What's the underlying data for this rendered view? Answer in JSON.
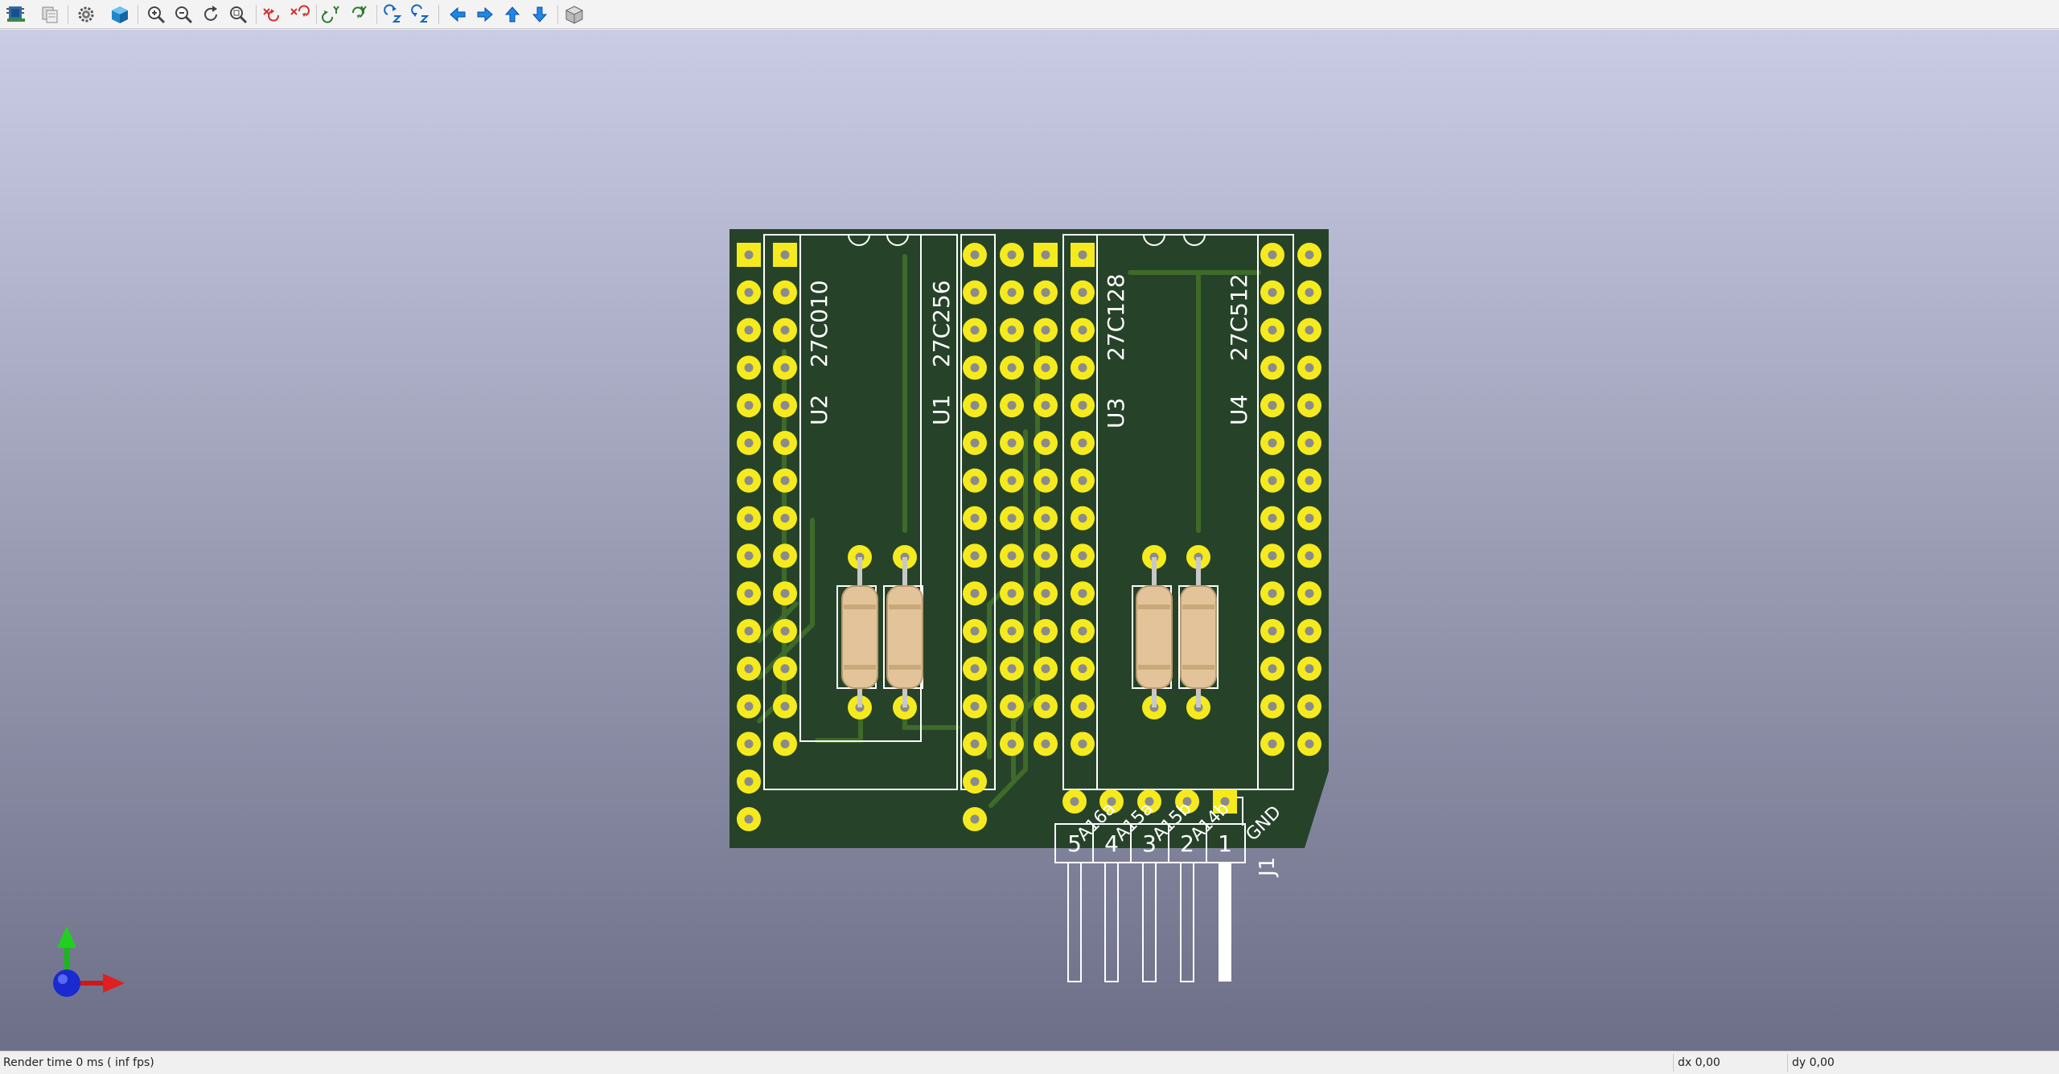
{
  "toolbar": {
    "tools": [
      {
        "icon": "pcbnew-icon"
      },
      {
        "icon": "copy-image-icon"
      },
      {
        "icon": "settings-gear-icon"
      },
      {
        "icon": "3d-cube-icon"
      },
      {
        "icon": "zoom-in-icon"
      },
      {
        "icon": "zoom-out-icon"
      },
      {
        "icon": "redraw-icon"
      },
      {
        "icon": "zoom-fit-icon"
      },
      {
        "icon": "rotate-x-clockwise-icon"
      },
      {
        "icon": "rotate-x-counterclockwise-icon"
      },
      {
        "icon": "rotate-y-clockwise-icon"
      },
      {
        "icon": "rotate-y-counterclockwise-icon"
      },
      {
        "icon": "rotate-z-clockwise-icon"
      },
      {
        "icon": "rotate-z-counterclockwise-icon"
      },
      {
        "icon": "move-left-icon"
      },
      {
        "icon": "move-right-icon"
      },
      {
        "icon": "move-up-icon"
      },
      {
        "icon": "move-down-icon"
      },
      {
        "icon": "ortho-view-icon"
      }
    ]
  },
  "board": {
    "chips": [
      {
        "ref": "U2",
        "value": "27C010"
      },
      {
        "ref": "U1",
        "value": "27C256"
      },
      {
        "ref": "U3",
        "value": "27C128"
      },
      {
        "ref": "U4",
        "value": "27C512"
      }
    ],
    "connector": {
      "ref": "J1",
      "signals": [
        "A16a",
        "A15a",
        "A15b",
        "A14b",
        "GND"
      ],
      "pin_numbers": [
        "5",
        "4",
        "3",
        "2",
        "1"
      ]
    }
  },
  "colors": {
    "pcb": "#26432a",
    "copper_trace": "#3e6a2a",
    "pad": "#f5ea1e",
    "silkscreen": "#ffffff",
    "resistor": "#e3c49a"
  },
  "status": {
    "render_time": "Render time 0 ms ( inf fps)",
    "dx": "dx 0,00",
    "dy": "dy 0,00"
  }
}
